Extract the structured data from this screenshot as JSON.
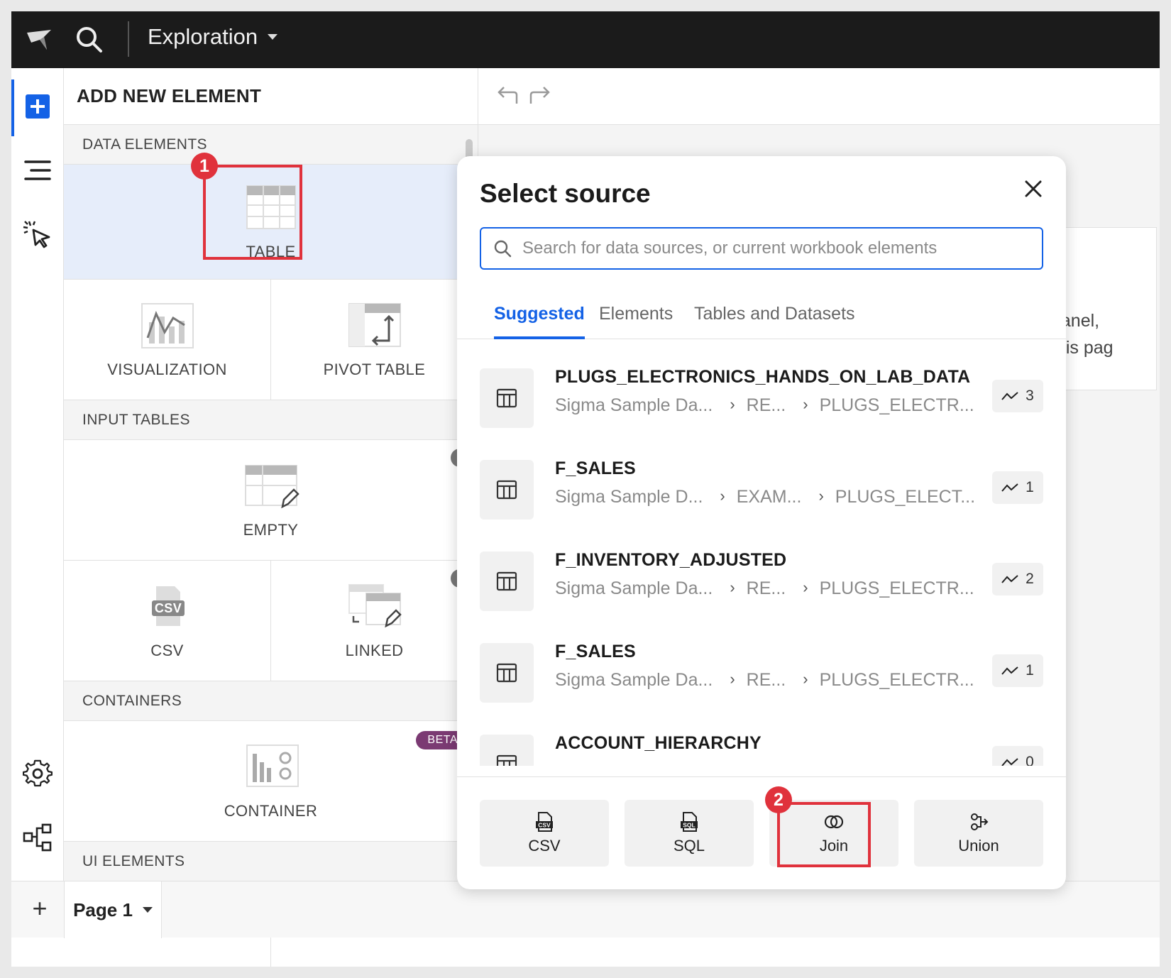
{
  "topbar": {
    "title": "Exploration"
  },
  "panel": {
    "header": "ADD NEW ELEMENT",
    "sections": {
      "data_elements": "DATA ELEMENTS",
      "input_tables": "INPUT TABLES",
      "containers": "CONTAINERS",
      "ui_elements": "UI ELEMENTS"
    },
    "tiles": {
      "table": "TABLE",
      "visualization": "VISUALIZATION",
      "pivot_table": "PIVOT TABLE",
      "empty": "EMPTY",
      "csv": "CSV",
      "linked": "LINKED",
      "container": "CONTAINER"
    },
    "info_glyph": "i",
    "beta_badge": "BETA"
  },
  "canvas": {
    "ghost_line1": "panel,",
    "ghost_line2": "this pag"
  },
  "annotations": {
    "marker1": "1",
    "marker2": "2",
    "color": "#e0323c"
  },
  "bottombar": {
    "add_glyph": "+",
    "page_tab": "Page 1"
  },
  "modal": {
    "title": "Select source",
    "search_placeholder": "Search for data sources, or current workbook elements",
    "tabs": [
      "Suggested",
      "Elements",
      "Tables and Datasets"
    ],
    "active_tab": "Suggested",
    "sources": [
      {
        "name": "PLUGS_ELECTRONICS_HANDS_ON_LAB_DATA",
        "path": [
          "Sigma Sample Da...",
          "RE...",
          "PLUGS_ELECTR..."
        ],
        "usage": "3"
      },
      {
        "name": "F_SALES",
        "path": [
          "Sigma Sample D...",
          "EXAM...",
          "PLUGS_ELECT..."
        ],
        "usage": "1"
      },
      {
        "name": "F_INVENTORY_ADJUSTED",
        "path": [
          "Sigma Sample Da...",
          "RE...",
          "PLUGS_ELECTR..."
        ],
        "usage": "2"
      },
      {
        "name": "F_SALES",
        "path": [
          "Sigma Sample Da...",
          "RE...",
          "PLUGS_ELECTR..."
        ],
        "usage": "1"
      },
      {
        "name": "ACCOUNT_HIERARCHY",
        "path": [
          "",
          "",
          ""
        ],
        "usage": "0"
      }
    ],
    "footer_buttons": {
      "csv": "CSV",
      "sql": "SQL",
      "join": "Join",
      "union": "Union"
    }
  },
  "colors": {
    "accent": "#1462e6",
    "topbar": "#1b1b1b",
    "beta": "#7b3a73",
    "selected_tile": "#e6edfa"
  }
}
